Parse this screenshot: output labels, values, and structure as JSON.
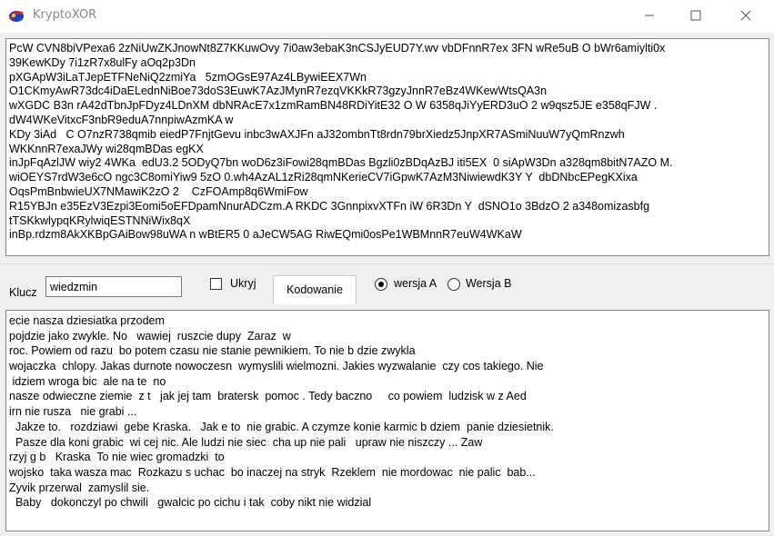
{
  "window": {
    "title": "KryptoXOR",
    "icon": "app-logo-icon"
  },
  "ciphertext_lines": [
    "PcW CVN8biVPexa6 2zNiUwZKJnowNt8Z7KKuwOvy 7i0aw3ebaK3nCSJyEUD7Y.wv vbDFnnR7ex 3FN wRe5uB O bWr6amiylti0x",
    "39KewKDy 7i1zR7x8ulFy aOq2p3Dn",
    "pXGApW3iLaTJepETFNeNiQ2zmiYa   5zmOGsE97Az4LBywiEEX7Wn",
    "O1CKmyAwR73dc4iDaELednNiBoe73doS3EuwK7AzJMynR7ezqVKKkR73gzyJnnR7eBz4WKewWtsQA3n",
    "wXGDC B3n rA42dTbnJpFDyz4LDnXM dbNRAcE7x1zmRamBN48RDiYitE32 O W 6358qJiYyERD3uO 2 w9qsz5JE e358qFJW .",
    "dW4WKeVitxcF3nbR9eduA7nnpiwAzmKA w",
    "KDy 3iAd   C O7nzR738qmib eiedP7FnjtGevu inbc3wAXJFn aJ32ombnTt8rdn79brXiedz5JnpXR7ASmiNuuW7yQmRnzwh",
    "WKKnnR7exaJWy wi28qmBDas egKX",
    "inJpFqAzlJW wiy2 4WKa  edU3.2 5ODyQ7bn woD6z3iFowi28qmBDas Bgzli0zBDqAzBJ iti5EX  0 siApW3Dn a328qm8bitN7AZO M.",
    "wiOEYS7rdW3e6cO ngc3C8omiYiw9 5zO 0.wh4AzAL1zRi28qmNKerieCV7iGpwK7AzM3NiwiewdK3Y Y  dbDNbcEPegKXixa",
    "OqsPmBnbwieUX7NMawiK2zO 2    CzFOAmp8q6WmiFow",
    "R15YBJn e35EzV3Ezpi3Eomi5oEFDpamNnurADCzm.A RKDC 3GnnpixvXTFn iW 6R3Dn Y  dSNO1o 3BdzO 2 a348omizasbfg",
    "tTSKkwlypqKRylwiqESTNNiWix8qX",
    "inBp.rdzm8AkXKBpGAiBow98uWA n wBtER5 0 aJeCW5AG RiwEQmi0osPe1WBMnnR7euW4WKaW"
  ],
  "controls": {
    "key_label": "Klucz",
    "key_value": "wiedzmin",
    "hide_label": "Ukryj",
    "hide_checked": false,
    "encode_button": "Kodowanie",
    "version_a_label": "wersja A",
    "version_b_label": "Wersja B",
    "selected_version": "A"
  },
  "plaintext_lines": [
    "ecie nasza dziesiatka przodem",
    "pojdzie jako zwykle. No   wawiej  ruszcie dupy  Zaraz  w",
    "roc. Powiem od razu  bo potem czasu nie stanie pewnikiem. To nie b dzie zwykla",
    "wojaczka  chlopy. Jakas durnote nowoczesn  wymyslili wielmozni. Jakies wyzwalanie  czy cos takiego. Nie",
    " idziem wroga bic  ale na te  no",
    "nasze odwieczne ziemie  z t   jak jej tam  bratersk  pomoc . Tedy baczno     co powiem  ludzisk w z Aed",
    "irn nie rusza   nie grabi ...",
    "  Jakze to.   rozdziawi  gebe Kraska.   Jak e to  nie grabic. A czymze konie karmic b dziem  panie dziesietnik.",
    "  Pasze dla koni grabic  wi cej nic. Ale ludzi nie siec  cha up nie pali   upraw nie niszczy ... Zaw",
    "rzyj g b   Kraska  To nie wiec gromadzki  to",
    "wojsko  taka wasza mac  Rozkazu s uchac  bo inaczej na stryk  Rzeklem  nie mordowac  nie palic  bab...",
    "Zyvik przerwal  zamyslil sie.",
    "  Baby   dokonczyl po chwili   gwalcic po cichu i tak  coby nikt nie widzial"
  ]
}
